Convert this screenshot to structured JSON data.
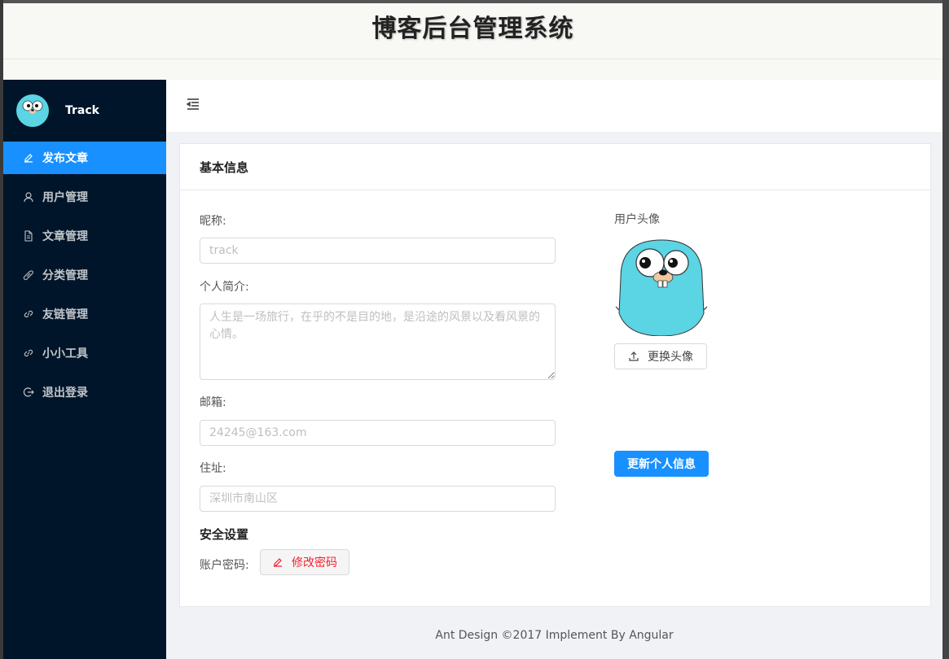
{
  "page_title": "博客后台管理系统",
  "sidebar": {
    "user_name": "Track",
    "items": [
      {
        "label": "发布文章",
        "icon": "edit-icon",
        "active": true
      },
      {
        "label": "用户管理",
        "icon": "user-icon",
        "active": false
      },
      {
        "label": "文章管理",
        "icon": "file-icon",
        "active": false
      },
      {
        "label": "分类管理",
        "icon": "tag-icon",
        "active": false
      },
      {
        "label": "友链管理",
        "icon": "link-icon",
        "active": false
      },
      {
        "label": "小小工具",
        "icon": "link-icon",
        "active": false
      },
      {
        "label": "退出登录",
        "icon": "logout-icon",
        "active": false
      }
    ]
  },
  "header": {
    "toggle_icon": "menu-fold-icon"
  },
  "card": {
    "title": "基本信息",
    "nickname": {
      "label": "昵称:",
      "placeholder": "track"
    },
    "bio": {
      "label": "个人简介:",
      "placeholder": "人生是一场旅行，在乎的不是目的地，是沿途的风景以及看风景的心情。"
    },
    "email": {
      "label": "邮箱:",
      "placeholder": "24245@163.com"
    },
    "address": {
      "label": "住址:",
      "placeholder": "深圳市南山区"
    },
    "security_title": "安全设置",
    "password_label": "账户密码:",
    "change_password_button": "修改密码",
    "avatar_label": "用户头像",
    "change_avatar_button": "更换头像",
    "update_button": "更新个人信息"
  },
  "footer": "Ant Design ©2017 Implement By Angular",
  "colors": {
    "sidebar_bg": "#001529",
    "primary": "#1890ff",
    "danger": "#f5222d",
    "gopher": "#5bd4e3"
  }
}
